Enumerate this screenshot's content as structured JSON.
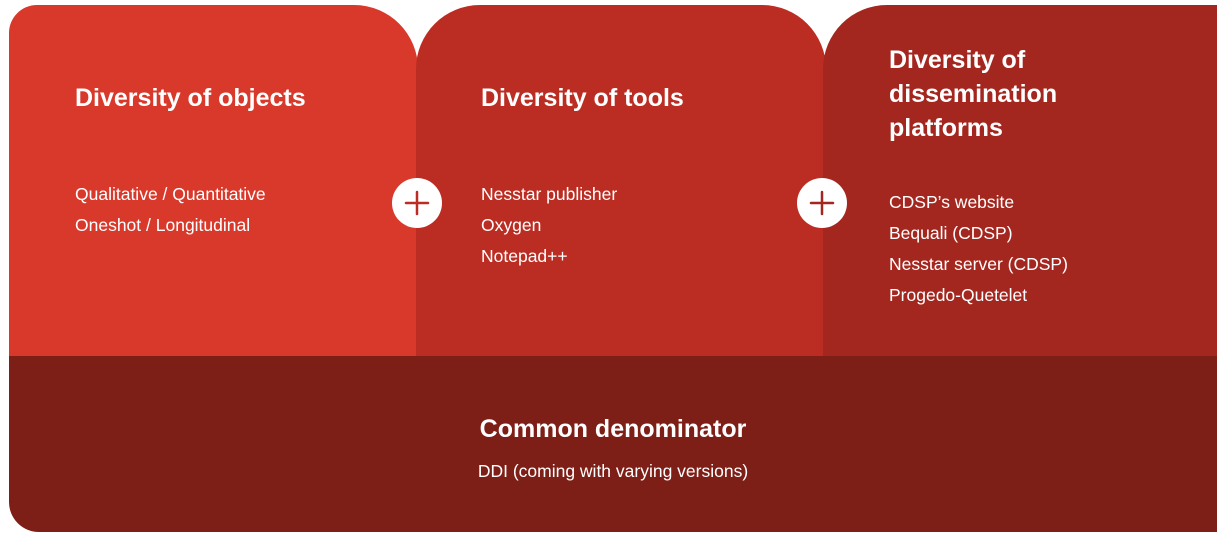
{
  "columns": [
    {
      "title": "Diversity of objects",
      "items": [
        "Qualitative / Quantitative",
        "Oneshot / Longitudinal"
      ],
      "color": "#d8392b"
    },
    {
      "title": "Diversity of tools",
      "items": [
        "Nesstar publisher",
        "Oxygen",
        "Notepad++"
      ],
      "color": "#bb2d22"
    },
    {
      "title": "Diversity of dissemination platforms",
      "items": [
        "CDSP’s website",
        "Bequali (CDSP)",
        "Nesstar server (CDSP)",
        "Progedo-Quetelet"
      ],
      "color": "#a4271f"
    }
  ],
  "connectors": [
    {
      "icon": "plus-icon"
    },
    {
      "icon": "plus-icon"
    }
  ],
  "footer": {
    "title": "Common denominator",
    "subtitle": "DDI (coming with varying versions)",
    "color": "#7d1f17"
  }
}
